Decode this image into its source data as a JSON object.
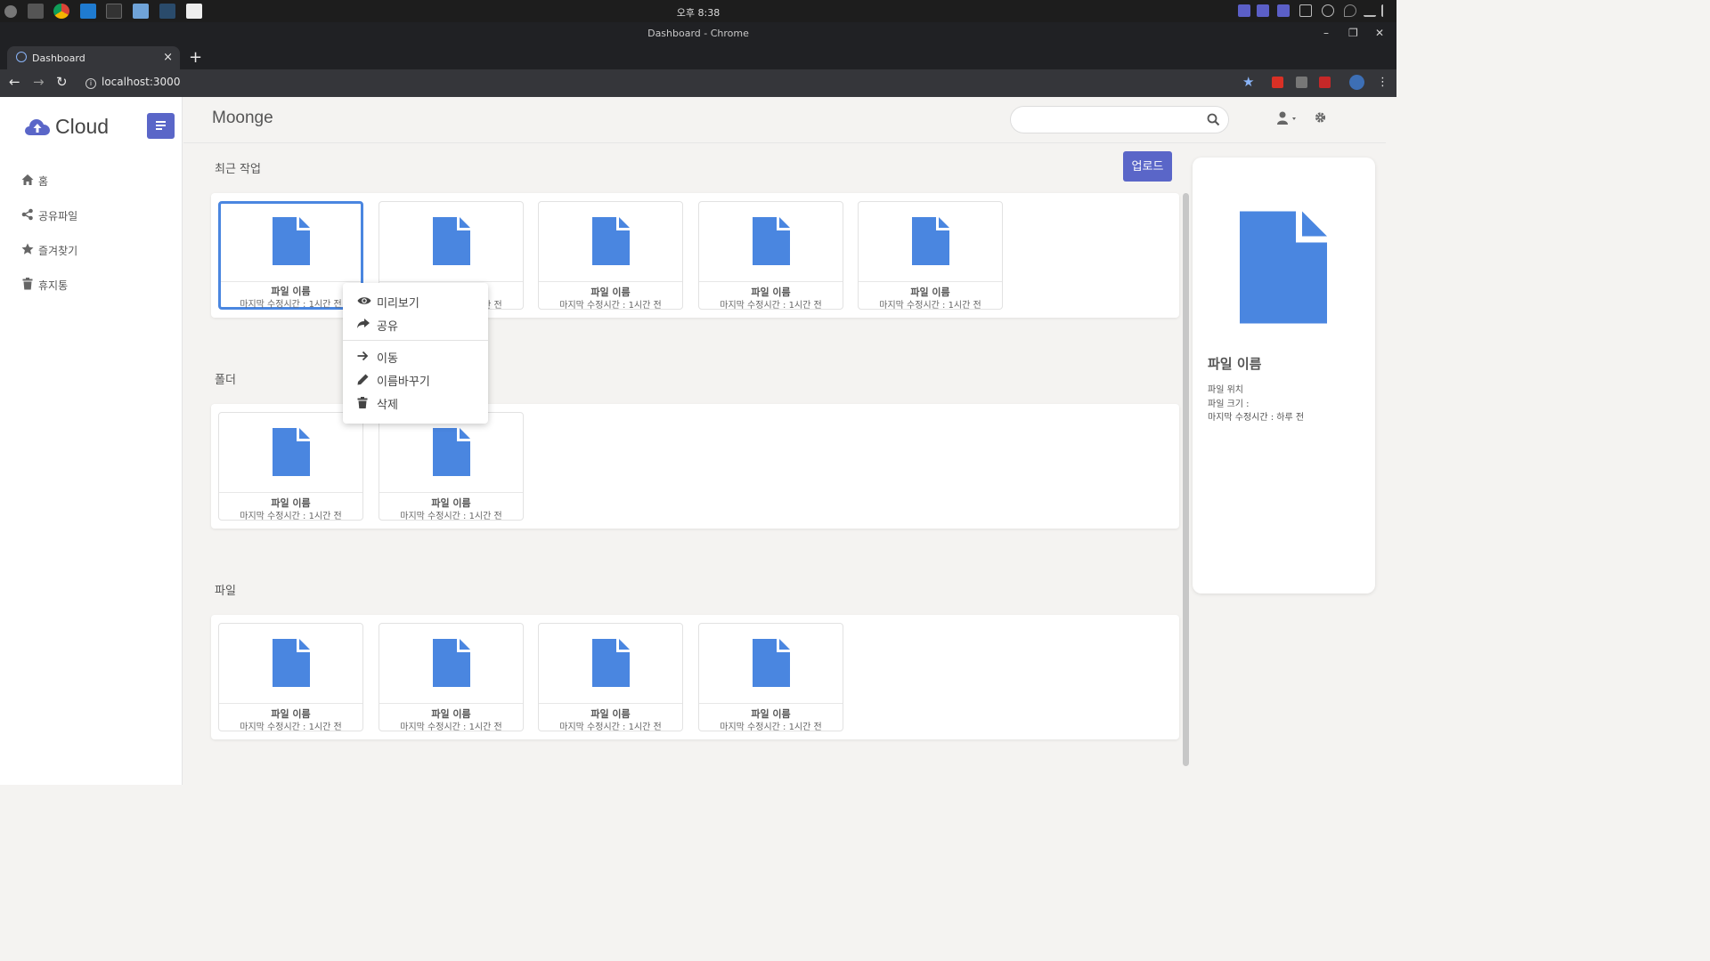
{
  "os": {
    "clock": "오후 8:38"
  },
  "window": {
    "title": "Dashboard - Chrome"
  },
  "browser": {
    "tab_title": "Dashboard",
    "url": "localhost:3000"
  },
  "sidebar": {
    "logo": "Cloud",
    "items": [
      {
        "label": "홈",
        "icon": "home-icon"
      },
      {
        "label": "공유파일",
        "icon": "share-alt-icon"
      },
      {
        "label": "즐겨찾기",
        "icon": "star-icon"
      },
      {
        "label": "휴지통",
        "icon": "trash-icon"
      }
    ]
  },
  "header": {
    "title": "Moonge",
    "search_placeholder": ""
  },
  "sections": {
    "recent": {
      "title": "최근 작업",
      "upload_label": "업로드"
    },
    "folders": {
      "title": "폴더"
    },
    "files": {
      "title": "파일"
    }
  },
  "card": {
    "name": "파일 이름",
    "modified": "마지막 수정시간 : 1시간 전"
  },
  "context_menu": {
    "items": [
      {
        "label": "미리보기",
        "icon": "eye-icon"
      },
      {
        "label": "공유",
        "icon": "share-icon"
      },
      {
        "label": "이동",
        "icon": "arrow-right-icon"
      },
      {
        "label": "이름바꾸기",
        "icon": "pencil-icon"
      },
      {
        "label": "삭제",
        "icon": "trash-icon"
      }
    ]
  },
  "detail": {
    "name": "파일 이름",
    "location": "파일 위치",
    "size": "파일 크기 :",
    "modified": "마지막 수정시간 : 하루 전"
  },
  "colors": {
    "accent": "#5a66c8",
    "file_icon": "#4a86e0",
    "selected_border": "#4a86e0"
  }
}
